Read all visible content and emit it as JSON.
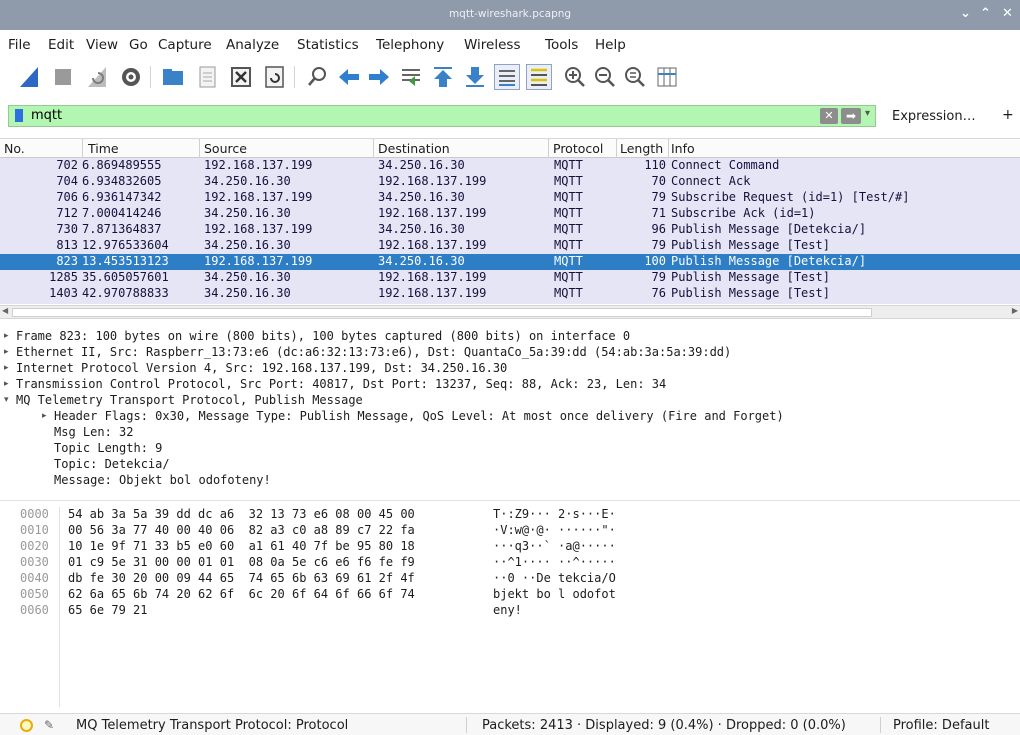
{
  "window": {
    "title": "mqtt-wireshark.pcapng",
    "controls": [
      "⌄",
      "⌃",
      "✕"
    ]
  },
  "menu": [
    "File",
    "Edit",
    "View",
    "Go",
    "Capture",
    "Analyze",
    "Statistics",
    "Telephony",
    "Wireless",
    "Tools",
    "Help"
  ],
  "toolbar": {
    "icons": [
      "shark-fin-start-icon",
      "stop-capture-icon",
      "restart-capture-icon",
      "capture-options-icon",
      "open-folder-icon",
      "save-file-icon",
      "close-file-icon",
      "reload-icon",
      "find-packet-icon",
      "go-back-icon",
      "go-forward-icon",
      "go-to-packet-icon",
      "go-first-icon",
      "go-last-icon",
      "autoscroll-icon",
      "colorize-icon",
      "zoom-in-icon",
      "zoom-out-icon",
      "zoom-normal-icon",
      "resize-columns-icon"
    ]
  },
  "filter": {
    "value": "mqtt",
    "expression_label": "Expression…",
    "plus_label": "+"
  },
  "packet_list": {
    "columns": [
      "No.",
      "Time",
      "Source",
      "Destination",
      "Protocol",
      "Length",
      "Info"
    ],
    "rows": [
      [
        "702",
        "6.869489555",
        "192.168.137.199",
        "34.250.16.30",
        "MQTT",
        "110",
        "Connect Command"
      ],
      [
        "704",
        "6.934832605",
        "34.250.16.30",
        "192.168.137.199",
        "MQTT",
        "70",
        "Connect Ack"
      ],
      [
        "706",
        "6.936147342",
        "192.168.137.199",
        "34.250.16.30",
        "MQTT",
        "79",
        "Subscribe Request (id=1) [Test/#]"
      ],
      [
        "712",
        "7.000414246",
        "34.250.16.30",
        "192.168.137.199",
        "MQTT",
        "71",
        "Subscribe Ack (id=1)"
      ],
      [
        "730",
        "7.871364837",
        "192.168.137.199",
        "34.250.16.30",
        "MQTT",
        "96",
        "Publish Message [Detekcia/]"
      ],
      [
        "813",
        "12.976533604",
        "34.250.16.30",
        "192.168.137.199",
        "MQTT",
        "79",
        "Publish Message [Test]"
      ],
      [
        "823",
        "13.453513123",
        "192.168.137.199",
        "34.250.16.30",
        "MQTT",
        "100",
        "Publish Message [Detekcia/]"
      ],
      [
        "1285",
        "35.605057601",
        "34.250.16.30",
        "192.168.137.199",
        "MQTT",
        "79",
        "Publish Message [Test]"
      ],
      [
        "1403",
        "42.970788833",
        "34.250.16.30",
        "192.168.137.199",
        "MQTT",
        "76",
        "Publish Message [Test]"
      ]
    ],
    "selected_index": 6
  },
  "details": [
    {
      "level": 0,
      "marker": "▸",
      "text": "Frame 823: 100 bytes on wire (800 bits), 100 bytes captured (800 bits) on interface 0"
    },
    {
      "level": 0,
      "marker": "▸",
      "text": "Ethernet II, Src: Raspberr_13:73:e6 (dc:a6:32:13:73:e6), Dst: QuantaCo_5a:39:dd (54:ab:3a:5a:39:dd)"
    },
    {
      "level": 0,
      "marker": "▸",
      "text": "Internet Protocol Version 4, Src: 192.168.137.199, Dst: 34.250.16.30"
    },
    {
      "level": 0,
      "marker": "▸",
      "text": "Transmission Control Protocol, Src Port: 40817, Dst Port: 13237, Seq: 88, Ack: 23, Len: 34"
    },
    {
      "level": 0,
      "marker": "▾",
      "text": "MQ Telemetry Transport Protocol, Publish Message"
    },
    {
      "level": 1,
      "marker": "▸",
      "text": "Header Flags: 0x30, Message Type: Publish Message, QoS Level: At most once delivery (Fire and Forget)"
    },
    {
      "level": 1,
      "marker": "",
      "text": "Msg Len: 32"
    },
    {
      "level": 1,
      "marker": "",
      "text": "Topic Length: 9"
    },
    {
      "level": 1,
      "marker": "",
      "text": "Topic: Detekcia/"
    },
    {
      "level": 1,
      "marker": "",
      "text": "Message: Objekt bol odofoteny!"
    }
  ],
  "hex_dump": [
    {
      "offset": "0000",
      "bytes": "54 ab 3a 5a 39 dd dc a6  32 13 73 e6 08 00 45 00",
      "ascii": "T·:Z9··· 2·s···E·"
    },
    {
      "offset": "0010",
      "bytes": "00 56 3a 77 40 00 40 06  82 a3 c0 a8 89 c7 22 fa",
      "ascii": "·V:w@·@· ······\"·"
    },
    {
      "offset": "0020",
      "bytes": "10 1e 9f 71 33 b5 e0 60  a1 61 40 7f be 95 80 18",
      "ascii": "···q3··` ·a@·····"
    },
    {
      "offset": "0030",
      "bytes": "01 c9 5e 31 00 00 01 01  08 0a 5e c6 e6 f6 fe f9",
      "ascii": "··^1···· ··^·····"
    },
    {
      "offset": "0040",
      "bytes": "db fe 30 20 00 09 44 65  74 65 6b 63 69 61 2f 4f",
      "ascii": "··0 ··De tekcia/O"
    },
    {
      "offset": "0050",
      "bytes": "62 6a 65 6b 74 20 62 6f  6c 20 6f 64 6f 66 6f 74",
      "ascii": "bjekt bo l odofot"
    },
    {
      "offset": "0060",
      "bytes": "65 6e 79 21",
      "ascii": "eny!"
    }
  ],
  "status": {
    "protocol": "MQ Telemetry Transport Protocol: Protocol",
    "packets": "Packets: 2413 · Displayed: 9 (0.4%) · Dropped: 0 (0.0%)",
    "profile": "Profile: Default"
  }
}
